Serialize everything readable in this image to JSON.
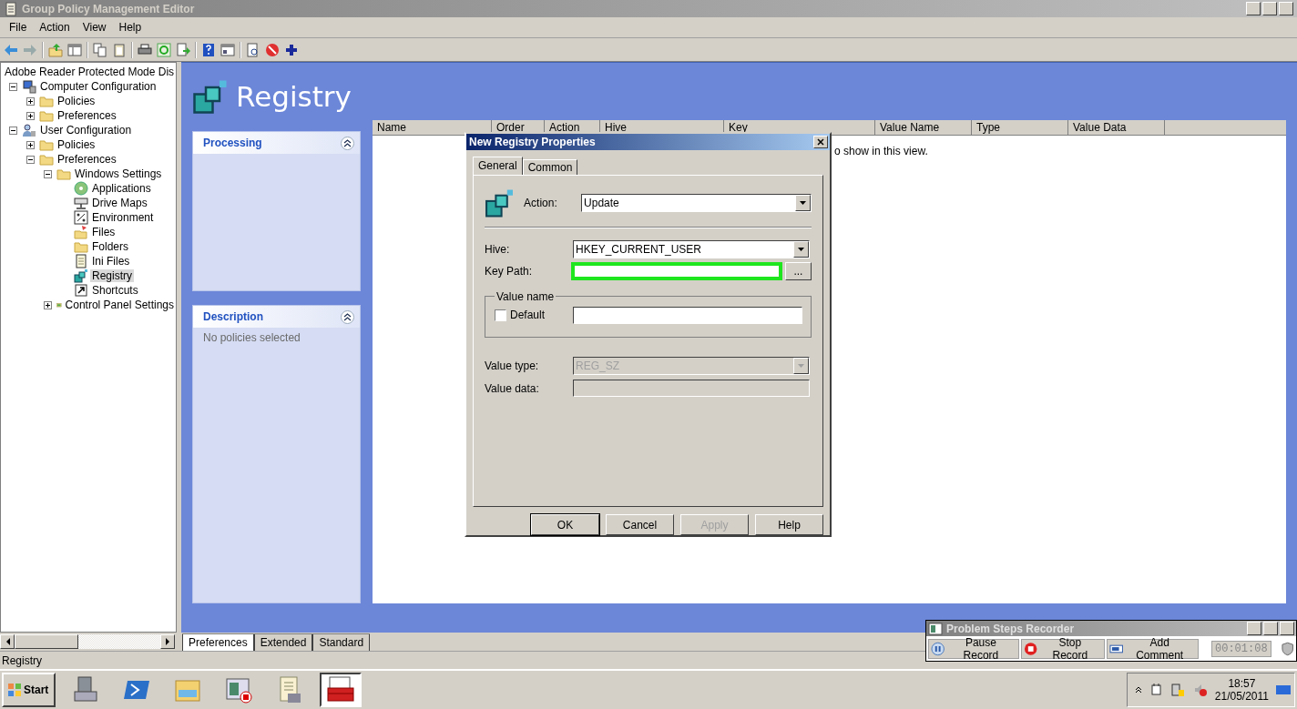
{
  "window": {
    "title": "Group Policy Management Editor"
  },
  "menu": [
    "File",
    "Action",
    "View",
    "Help"
  ],
  "tree": {
    "label": "Adobe Reader Protected Mode Dis",
    "selected": false,
    "children": [
      {
        "label": "Computer Configuration",
        "kind": "computer",
        "expanded": true,
        "selected": false,
        "children": [
          {
            "label": "Policies",
            "kind": "folder",
            "expanded": false,
            "selected": false
          },
          {
            "label": "Preferences",
            "kind": "folder",
            "expanded": false,
            "selected": false
          }
        ]
      },
      {
        "label": "User Configuration",
        "kind": "user",
        "expanded": true,
        "selected": false,
        "children": [
          {
            "label": "Policies",
            "kind": "folder",
            "expanded": false,
            "selected": false
          },
          {
            "label": "Preferences",
            "kind": "folder",
            "expanded": true,
            "selected": false,
            "children": [
              {
                "label": "Windows Settings",
                "kind": "folder",
                "expanded": true,
                "selected": false,
                "children": [
                  {
                    "label": "Applications",
                    "kind": "disc",
                    "selected": false
                  },
                  {
                    "label": "Drive Maps",
                    "kind": "drive",
                    "selected": false
                  },
                  {
                    "label": "Environment",
                    "kind": "percent",
                    "selected": false
                  },
                  {
                    "label": "Files",
                    "kind": "files",
                    "selected": false
                  },
                  {
                    "label": "Folders",
                    "kind": "folder",
                    "selected": false
                  },
                  {
                    "label": "Ini Files",
                    "kind": "ini",
                    "selected": false
                  },
                  {
                    "label": "Registry",
                    "kind": "cubes",
                    "selected": true
                  },
                  {
                    "label": "Shortcuts",
                    "kind": "shortcut",
                    "selected": false
                  }
                ]
              },
              {
                "label": "Control Panel Settings",
                "kind": "panel",
                "expanded": false,
                "selected": false
              }
            ]
          }
        ]
      }
    ]
  },
  "header": {
    "title": "Registry"
  },
  "panels": [
    {
      "title": "Processing"
    },
    {
      "title": "Description",
      "text": "No policies selected"
    }
  ],
  "table": {
    "columns": [
      "Name",
      "Order",
      "Action",
      "Hive",
      "Key",
      "Value Name",
      "Type",
      "Value Data"
    ],
    "empty_message": "o show in this view."
  },
  "view_tabs": [
    {
      "label": "Preferences",
      "selected": true
    },
    {
      "label": "Extended",
      "selected": false
    },
    {
      "label": "Standard",
      "selected": false
    }
  ],
  "status_bar": "Registry",
  "dialog": {
    "title": "New Registry Properties",
    "tabs": [
      {
        "label": "General",
        "selected": true
      },
      {
        "label": "Common",
        "selected": false
      }
    ],
    "action": {
      "label": "Action:",
      "value": "Update"
    },
    "hive": {
      "label": "Hive:",
      "value": "HKEY_CURRENT_USER"
    },
    "key_path": {
      "label": "Key Path:",
      "highlighted": true,
      "browse": "..."
    },
    "value_name": {
      "legend": "Value name",
      "default_label": "Default",
      "checked": false
    },
    "value_type": {
      "label": "Value type:",
      "value": "REG_SZ",
      "disabled": true
    },
    "value_data": {
      "label": "Value data:",
      "disabled": true
    },
    "buttons": [
      {
        "label": "OK",
        "disabled": false
      },
      {
        "label": "Cancel",
        "disabled": false
      },
      {
        "label": "Apply",
        "disabled": true
      },
      {
        "label": "Help",
        "disabled": false
      }
    ]
  },
  "taskbar": {
    "start": "Start",
    "apps": [
      {
        "kind": "server",
        "selected": false
      },
      {
        "kind": "shell",
        "selected": false
      },
      {
        "kind": "explorer",
        "selected": false
      },
      {
        "kind": "recorder",
        "selected": false
      },
      {
        "kind": "notepad",
        "selected": false
      },
      {
        "kind": "toolbox",
        "selected": true
      }
    ],
    "time": "18:57",
    "date": "21/05/2011"
  },
  "recorder": {
    "title": "Problem Steps Recorder",
    "buttons": [
      {
        "kind": "pause",
        "label": "Pause Record"
      },
      {
        "kind": "stop",
        "label": "Stop Record"
      },
      {
        "kind": "comment",
        "label": "Add Comment"
      }
    ],
    "timer": "00:01:08"
  }
}
